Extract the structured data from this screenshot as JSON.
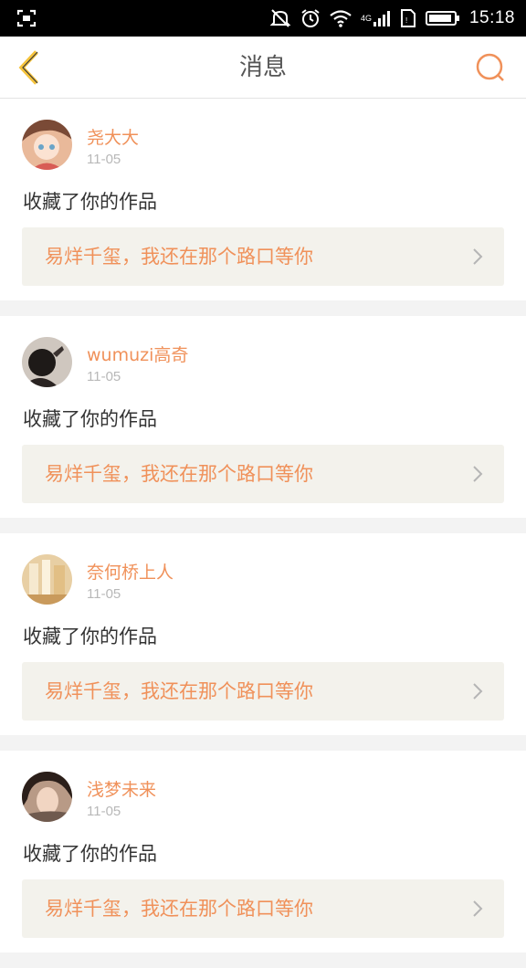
{
  "status_bar": {
    "time": "15:18",
    "network": "4G",
    "icons": [
      "screenshot-icon",
      "mute-icon",
      "alarm-icon",
      "wifi-icon",
      "signal-icon",
      "sim-icon",
      "battery-icon"
    ]
  },
  "header": {
    "title": "消息",
    "back_icon": "chevron-left-icon",
    "search_icon": "search-icon"
  },
  "colors": {
    "accent": "#f0915a",
    "back_arrow": "#f5c33b",
    "card_bg": "#ffffff",
    "work_bg": "#f3f2ec",
    "page_bg": "#f3f3f3"
  },
  "messages": [
    {
      "username": "尧大大",
      "date": "11-05",
      "action": "收藏了你的作品",
      "work_title": "易烊千玺，我还在那个路口等你"
    },
    {
      "username": "wumuzi高奇",
      "date": "11-05",
      "action": "收藏了你的作品",
      "work_title": "易烊千玺，我还在那个路口等你"
    },
    {
      "username": "奈何桥上人",
      "date": "11-05",
      "action": "收藏了你的作品",
      "work_title": "易烊千玺，我还在那个路口等你"
    },
    {
      "username": "浅梦未来",
      "date": "11-05",
      "action": "收藏了你的作品",
      "work_title": "易烊千玺，我还在那个路口等你"
    }
  ]
}
